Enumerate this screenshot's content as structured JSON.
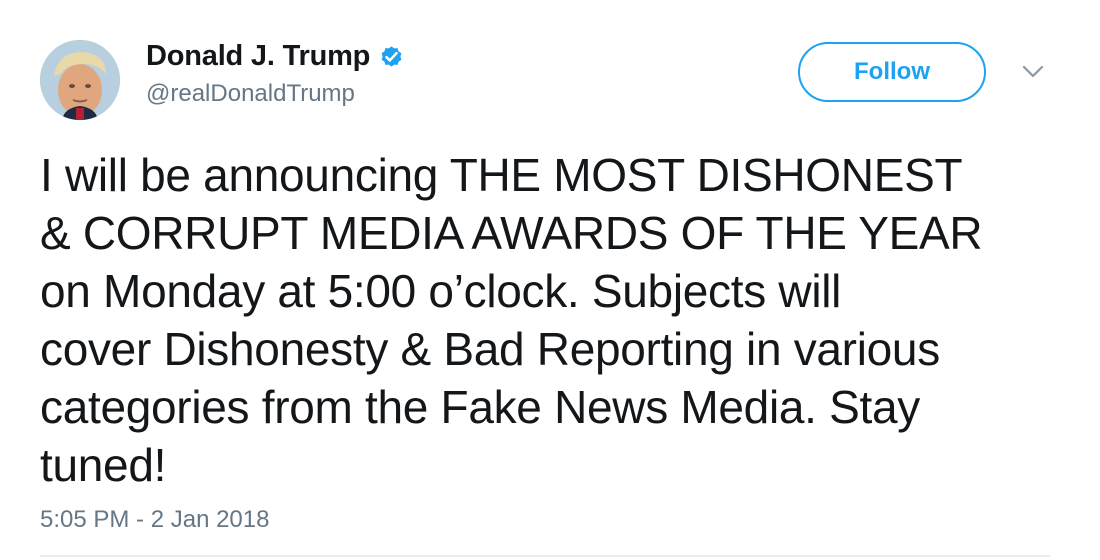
{
  "tweet": {
    "author": {
      "display_name": "Donald J. Trump",
      "handle": "@realDonaldTrump",
      "verified": true,
      "avatar_icon": "profile-photo"
    },
    "follow_label": "Follow",
    "menu_icon": "chevron-down-icon",
    "text": "I will be announcing THE MOST DISHONEST\n& CORRUPT MEDIA AWARDS OF THE YEAR\non Monday at 5:00 o’clock. Subjects will\ncover Dishonesty & Bad Reporting in various\ncategories from the Fake News Media. Stay\ntuned!",
    "timestamp": "5:05 PM - 2 Jan 2018"
  },
  "colors": {
    "accent": "#1da1f2",
    "text_primary": "#14171a",
    "text_secondary": "#657786",
    "divider": "#e6ecf0"
  }
}
